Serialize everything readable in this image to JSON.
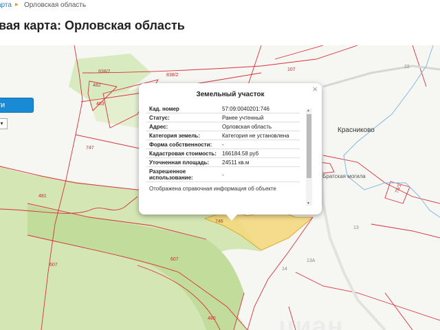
{
  "breadcrumb": {
    "link": "арта",
    "current": "Орловская область"
  },
  "page_title": "вая карта: Орловская область",
  "map": {
    "button_label": "ти",
    "select_value": "▾",
    "village_label": "Красниково",
    "memorial_label": "Братская могила",
    "watermark": "циан",
    "labels": {
      "p838_2a": "838/2",
      "p838_2b": "838/2",
      "p107": "107",
      "p482": "482",
      "p483": "483",
      "p747": "747",
      "p481": "481",
      "p607a": "607",
      "p607b": "607",
      "p480": "480",
      "p746": "746",
      "p75_1": "75/1",
      "p13": "13",
      "p13a": "13А",
      "p14": "14",
      "p22": "22"
    }
  },
  "popup": {
    "title": "Земельный участок",
    "close": "×",
    "rows": [
      {
        "key": "Кад. номер",
        "value": "57:09:0040201:746"
      },
      {
        "key": "Статус:",
        "value": "Ранее учтенный"
      },
      {
        "key": "Адрес:",
        "value": "Орловская область"
      },
      {
        "key": "Категория земель:",
        "value": "Категория не установлена"
      },
      {
        "key": "Форма собственности:",
        "value": "-"
      },
      {
        "key": "Кадастровая стоимость:",
        "value": "166184.58 руб"
      },
      {
        "key": "Уточненная площадь:",
        "value": "24511 кв.м"
      },
      {
        "key": "Разрешенное использование:",
        "value": "-"
      }
    ],
    "note": "Отображена справочная информация об объекте"
  },
  "colors": {
    "parcel_border": "#d9303a",
    "forest": "#c9dfa7",
    "highlight": "#f5d77a",
    "river": "#7ab4e0",
    "accent": "#1a8ad4"
  }
}
